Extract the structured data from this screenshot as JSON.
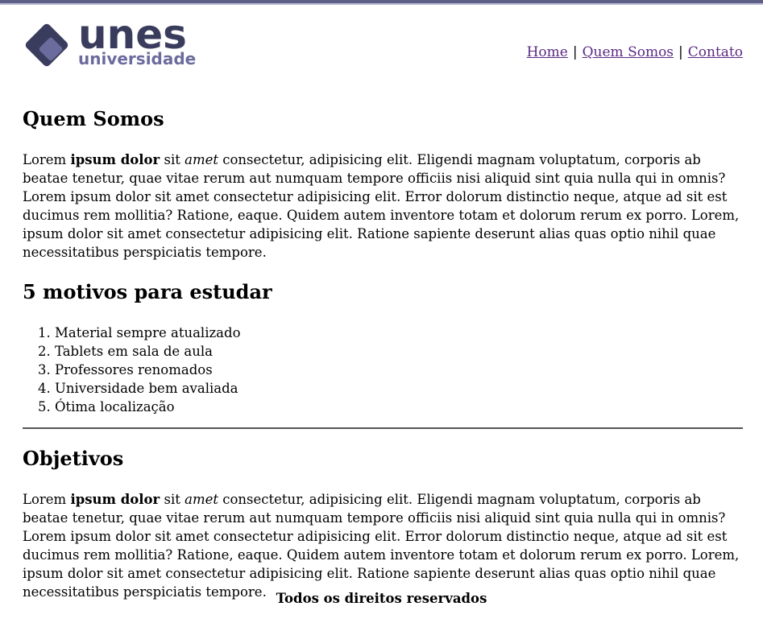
{
  "brand": {
    "name": "unes",
    "subtitle": "universidade",
    "colors": {
      "dark": "#3a3c5e",
      "light": "#6b6c9d",
      "top_bar": "#5e5f87"
    }
  },
  "nav": {
    "items": [
      {
        "label": "Home"
      },
      {
        "label": "Quem Somos"
      },
      {
        "label": "Contato"
      }
    ],
    "separator": "|"
  },
  "sections": {
    "about": {
      "title": "Quem Somos",
      "text_pre": "Lorem ",
      "text_bold": "ipsum dolor",
      "text_mid": " sit ",
      "text_italic": "amet",
      "text_post": " consectetur, adipisicing elit. Eligendi magnam voluptatum, corporis ab beatae tenetur, quae vitae rerum aut numquam tempore officiis nisi aliquid sint quia nulla qui in omnis? Lorem ipsum dolor sit amet consectetur adipisicing elit. Error dolorum distinctio neque, atque ad sit est ducimus rem mollitia? Ratione, eaque. Quidem autem inventore totam et dolorum rerum ex porro. Lorem, ipsum dolor sit amet consectetur adipisicing elit. Ratione sapiente deserunt alias quas optio nihil quae necessitatibus perspiciatis tempore."
    },
    "reasons": {
      "title": "5 motivos para estudar",
      "items": [
        "Material sempre atualizado",
        "Tablets em sala de aula",
        "Professores renomados",
        "Universidade bem avaliada",
        "Ótima localização"
      ]
    },
    "goals": {
      "title": "Objetivos",
      "text_pre": "Lorem ",
      "text_bold": "ipsum dolor",
      "text_mid": " sit ",
      "text_italic": "amet",
      "text_post": " consectetur, adipisicing elit. Eligendi magnam voluptatum, corporis ab beatae tenetur, quae vitae rerum aut numquam tempore officiis nisi aliquid sint quia nulla qui in omnis? Lorem ipsum dolor sit amet consectetur adipisicing elit. Error dolorum distinctio neque, atque ad sit est ducimus rem mollitia? Ratione, eaque. Quidem autem inventore totam et dolorum rerum ex porro. Lorem, ipsum dolor sit amet consectetur adipisicing elit. Ratione sapiente deserunt alias quas optio nihil quae necessitatibus perspiciatis tempore."
    }
  },
  "footer": {
    "text": "Todos os direitos reservados"
  }
}
